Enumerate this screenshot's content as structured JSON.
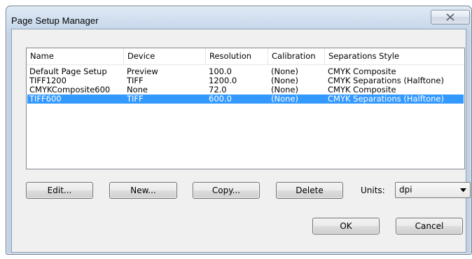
{
  "window": {
    "title": "Page Setup Manager"
  },
  "list": {
    "columns": [
      "Name",
      "Device",
      "Resolution",
      "Calibration",
      "Separations Style"
    ],
    "rows": [
      {
        "name": "Default Page Setup",
        "device": "Preview",
        "resolution": "100.0",
        "calibration": "(None)",
        "style": "CMYK Composite",
        "selected": false
      },
      {
        "name": "TIFF1200",
        "device": "TIFF",
        "resolution": "1200.0",
        "calibration": "(None)",
        "style": "CMYK Separations (Halftone)",
        "selected": false
      },
      {
        "name": "CMYKComposite600",
        "device": "None",
        "resolution": "72.0",
        "calibration": "(None)",
        "style": "CMYK Composite",
        "selected": false
      },
      {
        "name": "TIFF600",
        "device": "TIFF",
        "resolution": "600.0",
        "calibration": "(None)",
        "style": "CMYK Separations (Halftone)",
        "selected": true
      }
    ]
  },
  "buttons": {
    "edit": "Edit...",
    "new": "New...",
    "copy": "Copy...",
    "delete": "Delete",
    "ok": "OK",
    "cancel": "Cancel"
  },
  "units": {
    "label": "Units:",
    "value": "dpi"
  },
  "colors": {
    "selection": "#3399ff",
    "titlebar": "#c3d3e6"
  }
}
